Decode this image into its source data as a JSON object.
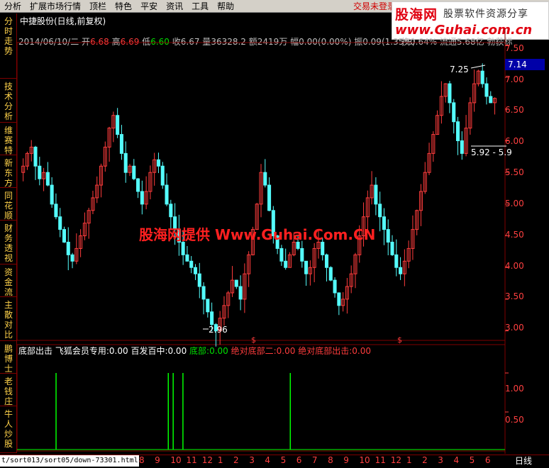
{
  "menu": {
    "items": [
      "分析",
      "扩展市场行情",
      "顶栏",
      "特色",
      "平安",
      "资讯",
      "工具",
      "帮助"
    ],
    "login_hint": "交易未登录"
  },
  "logo": {
    "name": "股海网",
    "slogan": "股票软件资源分享",
    "url": "www.Guhai.com.cn"
  },
  "side_tabs": [
    "分时走势",
    "技术分析",
    "维赛特",
    "新东方",
    "同花顺",
    "财务透视",
    "资金流",
    "主散对比",
    "鹏博士",
    "老钱庄",
    "牛人炒股"
  ],
  "title": "中捷股份(日线,前复权)",
  "quote": {
    "date": "2014/06/10/二",
    "open_label": "开",
    "open": "6.68",
    "high_label": "高",
    "high": "6.69",
    "low_label": "低",
    "low": "6.60",
    "close_label": "收",
    "close": "6.67",
    "vol_label": "量",
    "vol": "36328.2",
    "amt_label": "额",
    "amt": "2419万",
    "chg_label": "幅",
    "chg": "0.00(0.00%)",
    "amp_label": "振",
    "amp": "0.09(1.35%)",
    "tail": "换0.64% 流通5.68亿 勃荻标"
  },
  "chart_data": {
    "type": "candlestick",
    "price_axis": [
      "7.50",
      "7.00",
      "6.50",
      "6.00",
      "5.50",
      "5.00",
      "4.50",
      "4.00",
      "3.50",
      "3.00"
    ],
    "ylim": [
      2.85,
      7.55
    ],
    "last_price": "7.14",
    "annotations": {
      "high": "7.25",
      "low": "2.96",
      "range": "5.92 - 5.9"
    },
    "markers": [
      "$",
      "$"
    ],
    "closes": [
      5.5,
      5.6,
      5.8,
      5.9,
      5.6,
      5.4,
      5.5,
      5.3,
      5.0,
      4.8,
      4.6,
      4.4,
      4.2,
      4.1,
      4.3,
      4.5,
      4.7,
      4.9,
      5.1,
      5.3,
      5.6,
      5.9,
      6.2,
      6.4,
      6.1,
      5.8,
      5.5,
      5.6,
      5.4,
      5.2,
      5.0,
      5.2,
      5.5,
      5.7,
      5.6,
      5.3,
      5.0,
      4.8,
      4.6,
      4.4,
      4.2,
      4.1,
      4.0,
      3.9,
      3.7,
      3.5,
      3.3,
      3.1,
      3.0,
      3.2,
      3.4,
      3.6,
      3.8,
      3.7,
      3.5,
      3.9,
      4.2,
      4.6,
      5.0,
      5.5,
      5.3,
      4.9,
      4.5,
      4.3,
      4.1,
      4.0,
      4.2,
      4.4,
      4.3,
      4.1,
      3.9,
      4.0,
      4.3,
      4.4,
      4.2,
      4.0,
      3.8,
      3.6,
      3.4,
      3.5,
      3.7,
      3.9,
      4.2,
      4.5,
      4.8,
      5.1,
      5.3,
      5.0,
      4.8,
      4.6,
      4.4,
      4.2,
      4.0,
      3.9,
      4.1,
      4.3,
      4.6,
      4.9,
      5.2,
      5.5,
      5.8,
      6.1,
      6.4,
      6.7,
      6.9,
      6.6,
      6.3,
      6.0,
      5.8,
      6.2,
      6.6,
      6.9,
      7.1,
      6.9,
      6.7,
      6.6,
      6.67
    ],
    "indicator": {
      "yticks": [
        "1.00",
        "0.50"
      ],
      "signals": [
        0.08,
        0.31,
        0.32,
        0.34,
        0.56
      ]
    }
  },
  "indicator": {
    "name": "底部出击",
    "p1_label": "飞狐会员专用:",
    "p1": "0.00",
    "p2_label": "百发百中:",
    "p2": "0.00",
    "p3_label": "底部:",
    "p3": "0.00",
    "p4_label": "绝对底部二:",
    "p4": "0.00",
    "p5_label": "绝对底部出击:",
    "p5": "0.00"
  },
  "watermark": "股海网提供 Www.Guhai.Com.CN",
  "bottom": {
    "url": "t/sort013/sort05/down-73301.html",
    "date_ticks": [
      "8",
      "9",
      "10",
      "11",
      "12",
      "1",
      "2",
      "3",
      "4",
      "5",
      "6",
      "7",
      "8",
      "9",
      "10",
      "11",
      "12",
      "1",
      "2",
      "3",
      "4",
      "5",
      "6"
    ],
    "period": "日线"
  },
  "colors": {
    "up": "#ff3c3c",
    "down": "#54fcfc",
    "axis_text": "#ff4040",
    "grid": "#800000",
    "signal": "#00ff00"
  }
}
